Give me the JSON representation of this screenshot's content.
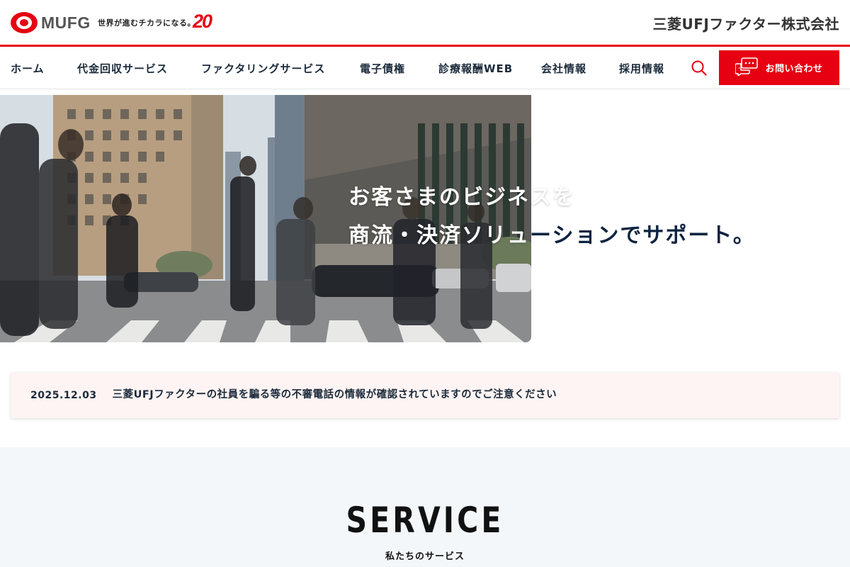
{
  "header": {
    "logo_text": "MUFG",
    "tagline": "世界が進むチカラになる。",
    "anniversary": "20",
    "company_name": "三菱UFJファクター株式会社"
  },
  "nav": {
    "items": [
      {
        "label": "ホーム"
      },
      {
        "label": "代金回収サービス"
      },
      {
        "label": "ファクタリングサービス"
      },
      {
        "label": "電子債権"
      },
      {
        "label": "診療報酬WEB"
      },
      {
        "label": "会社情報"
      },
      {
        "label": "採用情報"
      }
    ],
    "contact_label": "お問い合わせ"
  },
  "hero": {
    "line1_photo": "お客さまのビジネスを",
    "line1_rest": "",
    "line2_photo": "商流・決済ソリュ",
    "line2_rest": "ーションでサポート。"
  },
  "notice": {
    "date": "2025.12.03",
    "text": "三菱UFJファクターの社員を騙る等の不審電話の情報が確認されていますのでご注意ください"
  },
  "service": {
    "title": "SERVICE",
    "subtitle": "私たちのサービス"
  },
  "colors": {
    "brand_red": "#e60012",
    "navy_text": "#0e2340",
    "notice_bg": "#fdf4f3",
    "service_bg": "#f3f7fa"
  }
}
